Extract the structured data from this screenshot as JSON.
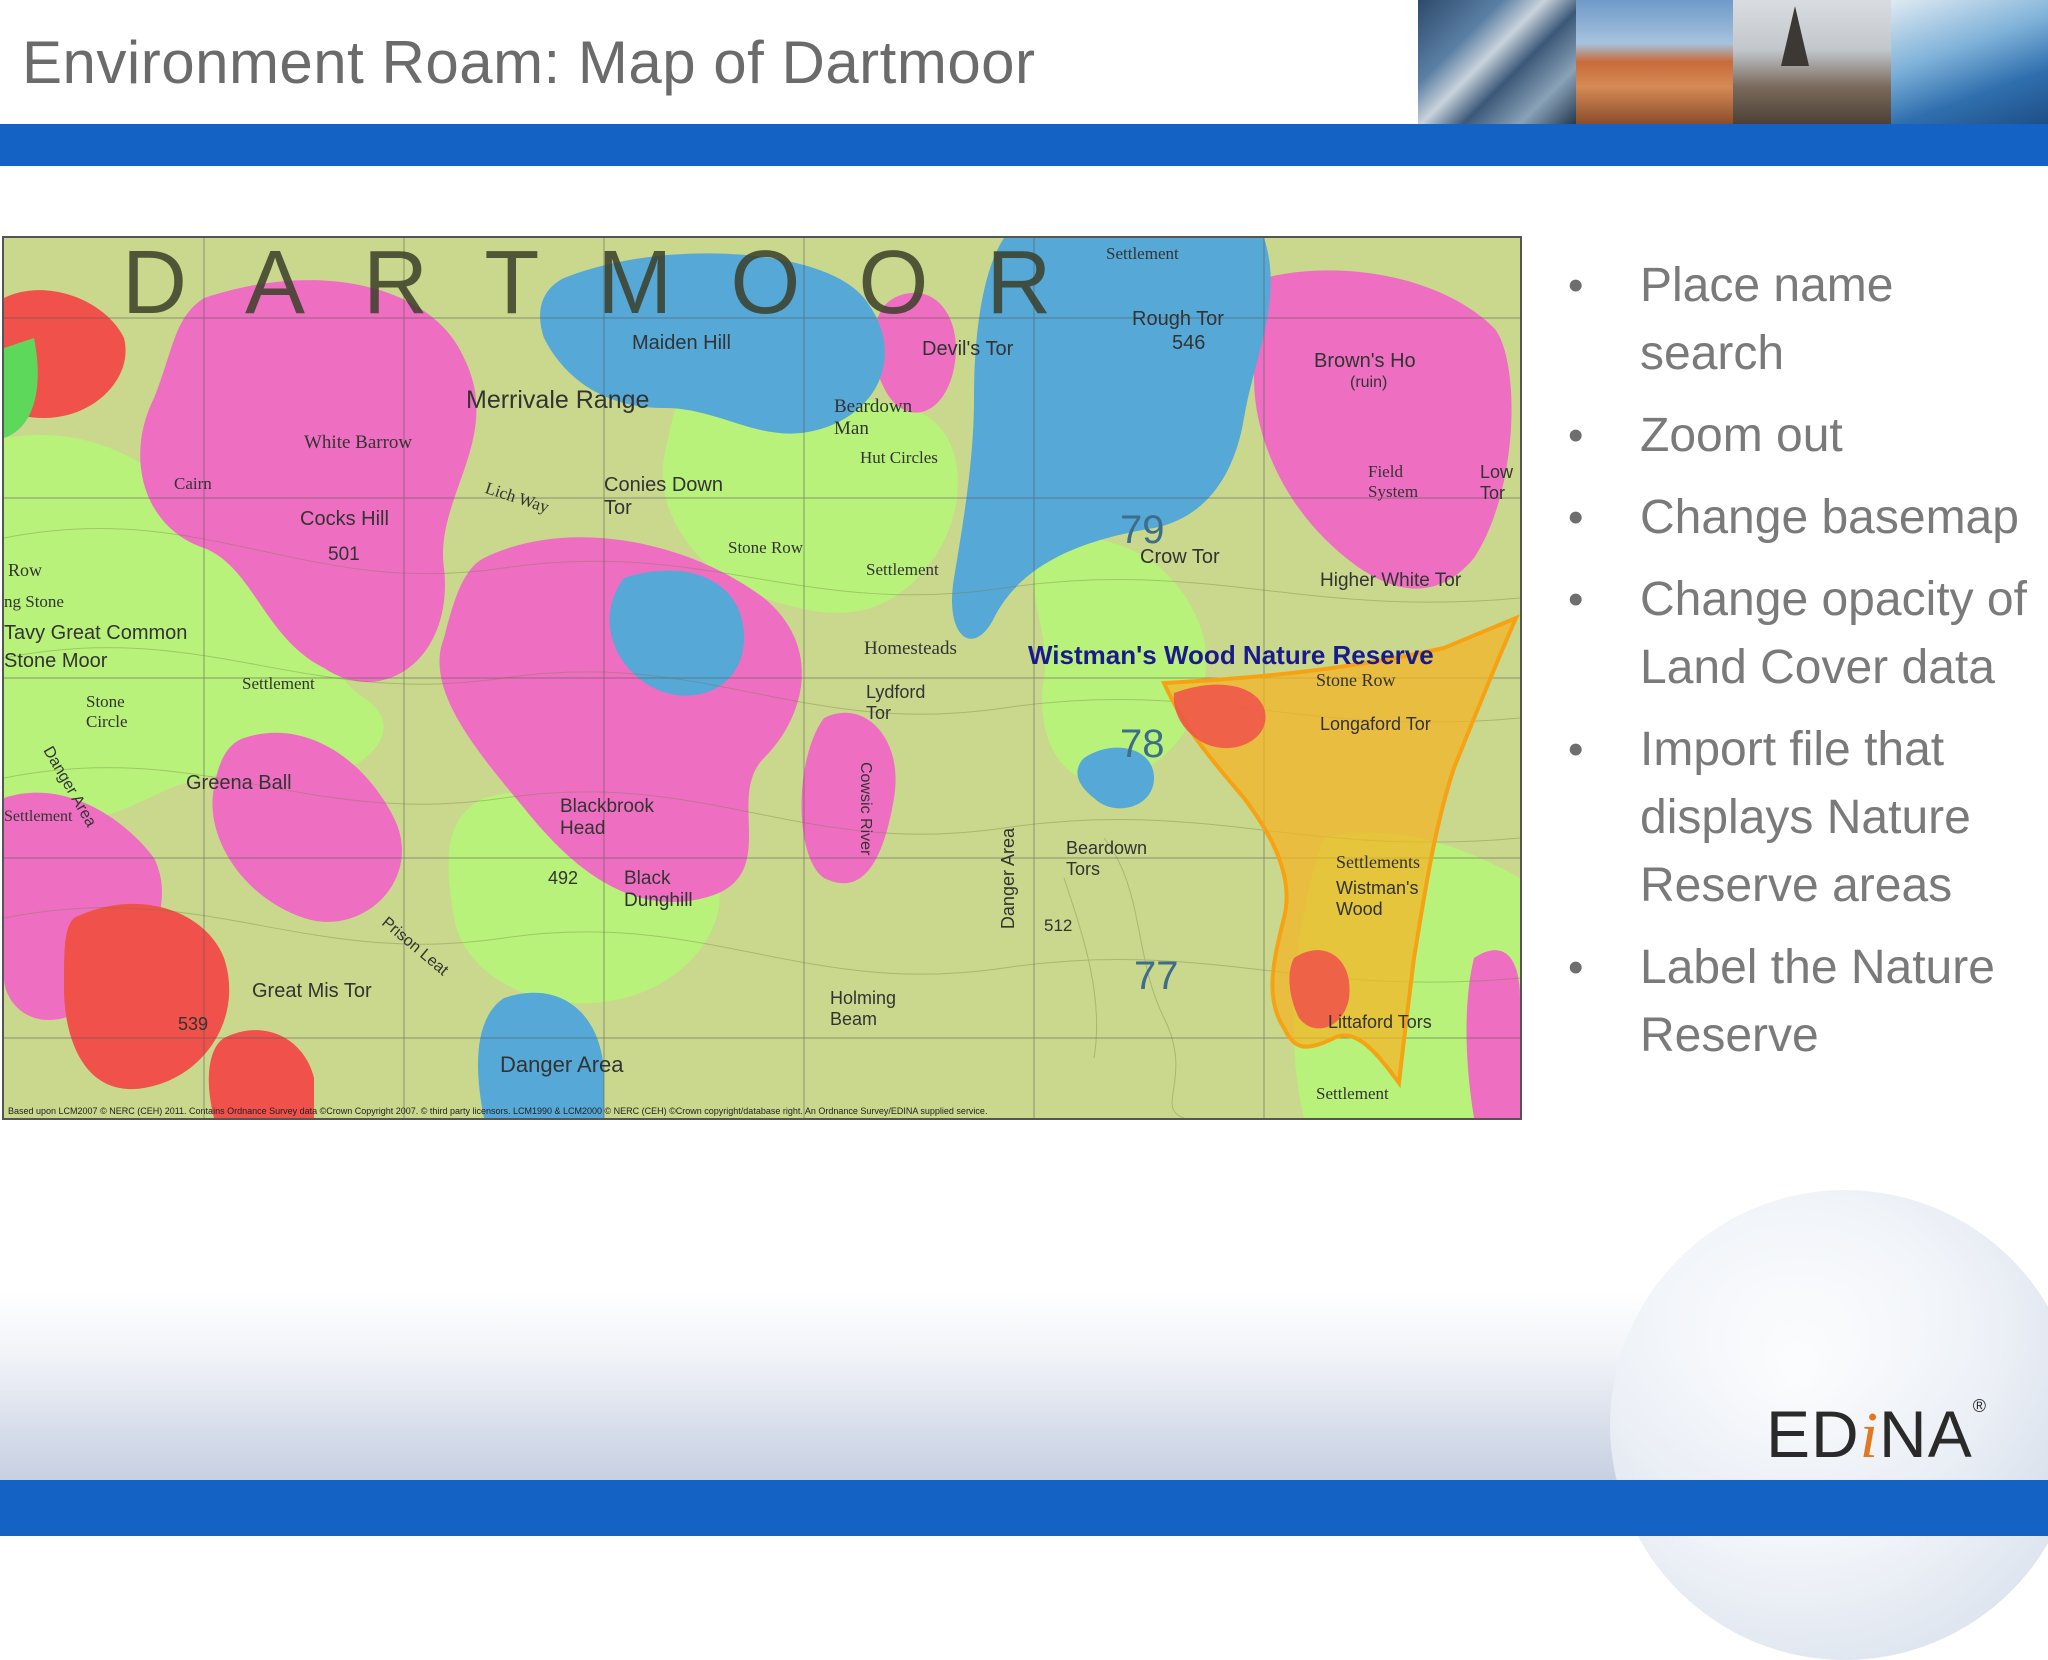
{
  "slide": {
    "title": "Environment Roam: Map of Dartmoor"
  },
  "map": {
    "headline": "DARTMOOR",
    "highlight_label": "Wistman's Wood Nature Reserve",
    "place_labels": [
      "Maiden Hill",
      "Merrivale Range",
      "Devil's Tor",
      "Rough Tor",
      "546",
      "Brown's Ho",
      "(ruin)",
      "White Barrow",
      "Cairn",
      "Cocks Hill",
      "501",
      "Conies Down Tor",
      "Beardown Man",
      "Hut Circles",
      "Stone Row",
      "Settlement",
      "79",
      "Crow Tor",
      "Higher White Tor",
      "Field System",
      "Low Tor",
      "Homesteads",
      "Lydford Tor",
      "Stone Row",
      "Longaford Tor",
      "78",
      "Tavy Great Common",
      "Stone Moor",
      "Stone Circle",
      "Greena Ball",
      "Settlement",
      "Blackbrook Head",
      "492",
      "Black Dunghill",
      "Cowsic River",
      "Danger Area",
      "Beardown Tors",
      "512",
      "Settlements",
      "Wistman's Wood",
      "77",
      "Great Mis Tor",
      "539",
      "Prison Leat",
      "Danger Area",
      "Holming Beam",
      "Littaford Tors",
      "Settlement",
      "Row",
      "ng Stone",
      "Settlement",
      "Lich Way",
      "Danger Area",
      "Settlement",
      "Settlement"
    ],
    "credit": "Based upon LCM2007 © NERC (CEH) 2011. Contains Ordnance Survey data ©Crown Copyright 2007. © third party licensors. LCM1990 & LCM2000 © NERC (CEH) ©Crown copyright/database right. An Ordnance Survey/EDINA supplied service."
  },
  "bullets": [
    "Place name search",
    "Zoom out",
    "Change basemap",
    "Change opacity of Land Cover data",
    "Import file that displays Nature Reserve areas",
    "Label the Nature Reserve"
  ],
  "logo": {
    "text_before": "ED",
    "text_i": "i",
    "text_after": "NA",
    "registered": "®"
  },
  "colors": {
    "brand_blue": "#1463c4",
    "title_gray": "#6b6b6b",
    "bullet_gray": "#7a7a7a",
    "map_pink": "#ee6fc1",
    "map_blue": "#56a8d7",
    "map_green": "#b8f27a",
    "map_olive": "#c9d88d",
    "map_red": "#f0514a",
    "reserve_orange": "#f5b323"
  }
}
